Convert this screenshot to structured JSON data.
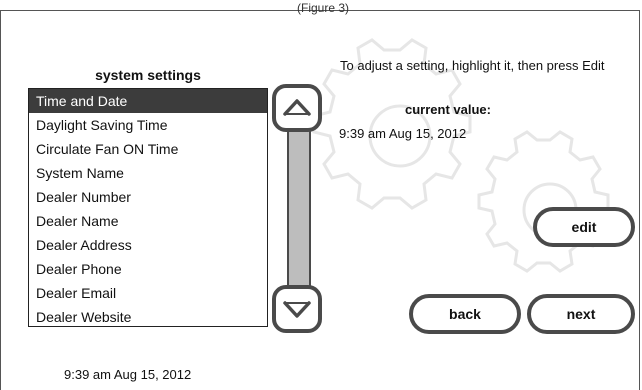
{
  "top_caption": "(Figure 3)",
  "list": {
    "title": "system settings",
    "items": [
      "Time and Date",
      "Daylight Saving Time",
      "Circulate Fan ON Time",
      "System Name",
      "Dealer Number",
      "Dealer Name",
      "Dealer Address",
      "Dealer Phone",
      "Dealer Email",
      "Dealer Website"
    ],
    "selected_index": 0
  },
  "scroll": {
    "up_icon": "chevron-up-icon",
    "down_icon": "chevron-down-icon"
  },
  "detail": {
    "instruction": "To adjust a setting, highlight it, then press Edit",
    "current_value_label": "current value:",
    "current_value": "9:39 am Aug 15, 2012"
  },
  "buttons": {
    "edit": "edit",
    "back": "back",
    "next": "next"
  },
  "footer": {
    "time": "9:39 am Aug 15, 2012"
  },
  "colors": {
    "selected_bg": "#3c3c3c",
    "border": "#4a4a4a",
    "scroll_track": "#bdbdbd"
  }
}
